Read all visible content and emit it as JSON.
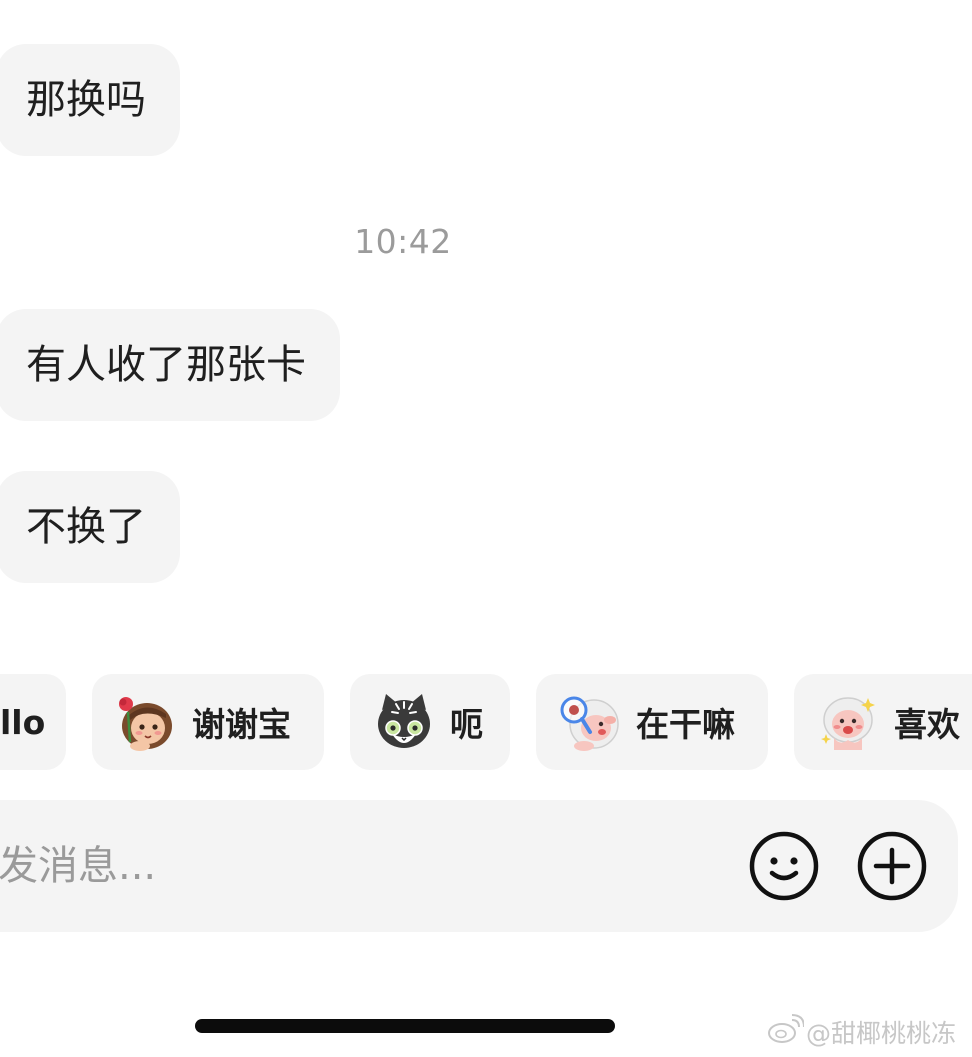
{
  "messages": [
    {
      "text": "那换吗"
    },
    {
      "text": "有人收了那张卡"
    },
    {
      "text": "不换了"
    }
  ],
  "timestamp": "10:42",
  "quick_replies": [
    {
      "label": "llo",
      "sticker": "none"
    },
    {
      "label": "谢谢宝",
      "sticker": "girl-holding-rose-sticker"
    },
    {
      "label": "呃",
      "sticker": "black-cat-sticker"
    },
    {
      "label": "在干嘛",
      "sticker": "sheep-magnifier-sticker"
    },
    {
      "label": "喜欢",
      "sticker": "sheep-sparkle-sticker"
    }
  ],
  "composer": {
    "placeholder": "发消息...",
    "value": "",
    "emoji_icon": "smiley-face-icon",
    "plus_icon": "plus-circle-icon"
  },
  "watermark": {
    "text": "@甜椰桃桃冻",
    "icon": "weibo-logo-icon"
  },
  "colors": {
    "bubble_bg": "#f4f4f4",
    "text": "#1f1f1f",
    "timestamp": "#9b9b9b",
    "placeholder": "#9a9a9a"
  }
}
